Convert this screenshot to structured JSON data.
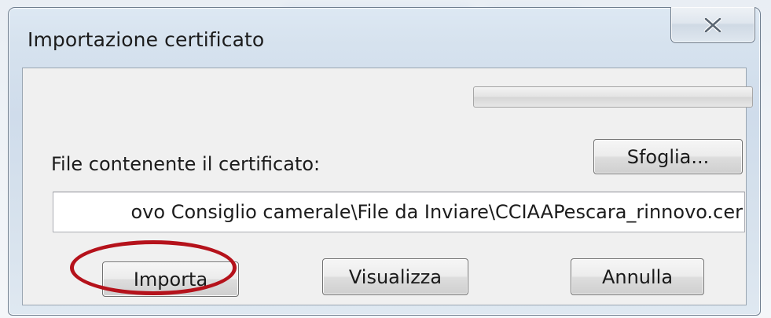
{
  "dialog": {
    "title": "Importazione certificato",
    "close_icon": "close-x-icon",
    "progress": {
      "value_percent": 0
    },
    "file_label": "File contenente il certificato:",
    "browse_button": "Sfoglia...",
    "file_path": "ovo Consiglio camerale\\File da Inviare\\CCIAAPescara_rinnovo.cer",
    "buttons": {
      "import": "Importa",
      "view": "Visualizza",
      "cancel": "Annulla"
    }
  },
  "annotation": {
    "highlight_color": "#b5121b",
    "highlighted_target": "import-button"
  }
}
